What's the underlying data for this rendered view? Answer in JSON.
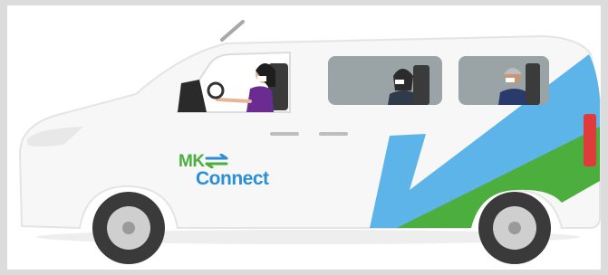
{
  "logo": {
    "line1": "MK",
    "line2": "Connect"
  },
  "colors": {
    "van_body": "#f7f7f7",
    "van_outline": "#e6e6e6",
    "livery_blue": "#5db4e8",
    "livery_green": "#4caf3d",
    "logo_green": "#4caf3d",
    "logo_blue": "#2a8fd6",
    "window_tint": "#9aa3a6",
    "tail_light": "#e03b3b",
    "tyre": "#3a3a3a",
    "rim": "#cfcfcf",
    "driver_shirt": "#6a2c91"
  },
  "icons": [
    "van-illustration",
    "driver-figure",
    "passenger-figure",
    "passenger-figure",
    "logo-arrows-icon"
  ]
}
